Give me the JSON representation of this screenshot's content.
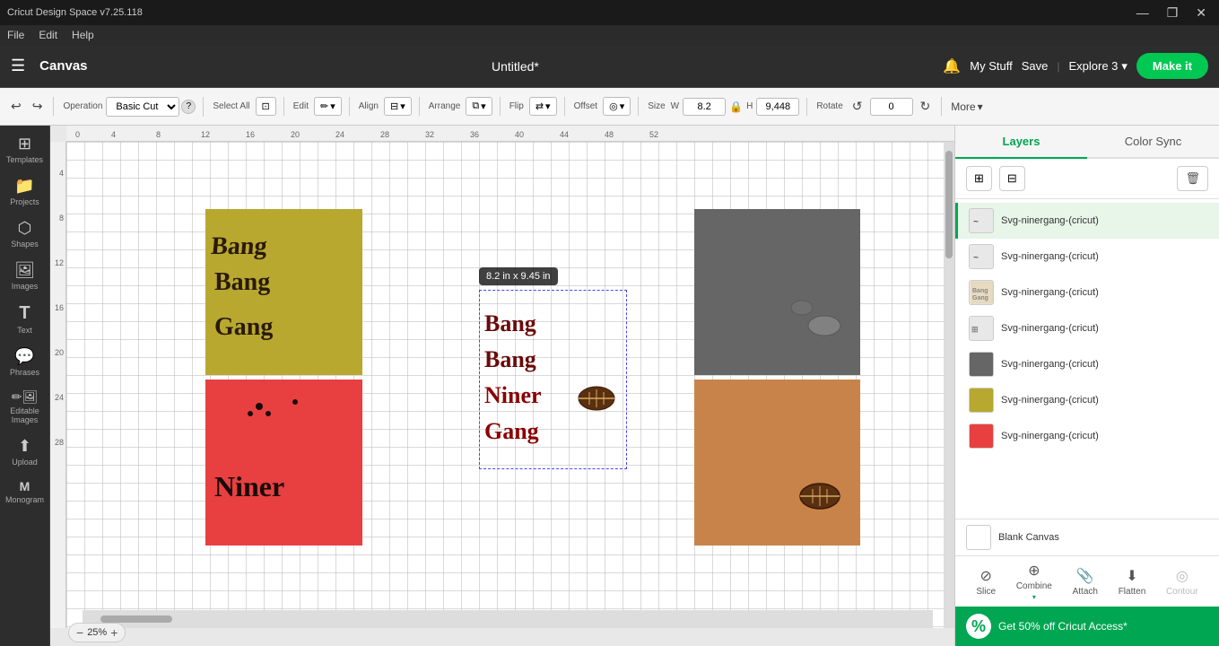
{
  "titlebar": {
    "title": "Cricut Design Space  v7.25.118",
    "controls": {
      "minimize": "—",
      "maximize": "❐",
      "close": "✕"
    }
  },
  "menubar": {
    "items": [
      "File",
      "Edit",
      "Help"
    ]
  },
  "header": {
    "hamburger": "☰",
    "canvas_label": "Canvas",
    "doc_title": "Untitled*",
    "bell_label": "🔔",
    "mystuff_label": "My Stuff",
    "save_label": "Save",
    "divider": "|",
    "machine_label": "Explore 3",
    "machine_chevron": "▾",
    "makeit_label": "Make it"
  },
  "toolbar": {
    "undo_label": "↩",
    "redo_label": "↪",
    "operation_label": "Operation",
    "operation_value": "Basic Cut",
    "help_label": "?",
    "select_all_label": "Select All",
    "edit_label": "Edit",
    "edit_icon": "✏",
    "align_label": "Align",
    "arrange_label": "Arrange",
    "flip_label": "Flip",
    "offset_label": "Offset",
    "size_label": "Size",
    "size_w_label": "W",
    "size_w_value": "8.2",
    "size_h_label": "H",
    "size_h_value": "9,448",
    "lock_icon": "🔒",
    "rotate_label": "Rotate",
    "rotate_value": "0",
    "more_label": "More",
    "more_chevron": "▾"
  },
  "left_sidebar": {
    "items": [
      {
        "id": "templates",
        "icon": "⊞",
        "label": "Templates"
      },
      {
        "id": "projects",
        "icon": "📁",
        "label": "Projects"
      },
      {
        "id": "shapes",
        "icon": "⬡",
        "label": "Shapes"
      },
      {
        "id": "images",
        "icon": "🖼",
        "label": "Images"
      },
      {
        "id": "text",
        "icon": "T",
        "label": "Text"
      },
      {
        "id": "phrases",
        "icon": "💬",
        "label": "Phrases"
      },
      {
        "id": "editable_images",
        "icon": "✏",
        "label": "Editable Images"
      },
      {
        "id": "upload",
        "icon": "⬆",
        "label": "Upload"
      },
      {
        "id": "monogram",
        "icon": "M",
        "label": "Monogram"
      }
    ]
  },
  "canvas": {
    "zoom_level": "25%",
    "zoom_minus": "−",
    "zoom_plus": "+",
    "size_tooltip": "8.2  in x 9.45  in",
    "ruler_marks_h": [
      "0",
      "4",
      "8",
      "12",
      "16",
      "20",
      "24",
      "28",
      "32",
      "36",
      "40",
      "44",
      "48",
      "52"
    ],
    "ruler_marks_v": [
      "4",
      "8",
      "12",
      "16",
      "20",
      "24",
      "28"
    ]
  },
  "right_panel": {
    "tabs": [
      {
        "id": "layers",
        "label": "Layers",
        "active": true
      },
      {
        "id": "color_sync",
        "label": "Color Sync",
        "active": false
      }
    ],
    "actions": {
      "group_icon": "⊞",
      "ungroup_icon": "⊟",
      "delete_icon": "🗑"
    },
    "layers": [
      {
        "id": 1,
        "name": "Svg-ninergang-(cricut)",
        "thumb_color": "#888",
        "thumb_icon": "~",
        "active": true
      },
      {
        "id": 2,
        "name": "Svg-ninergang-(cricut)",
        "thumb_color": "#888",
        "thumb_icon": "~",
        "active": false
      },
      {
        "id": 3,
        "name": "Svg-ninergang-(cricut)",
        "thumb_color": "#888",
        "thumb_icon": "▦",
        "active": false
      },
      {
        "id": 4,
        "name": "Svg-ninergang-(cricut)",
        "thumb_color": "#888",
        "thumb_icon": "⊞",
        "active": false
      },
      {
        "id": 5,
        "name": "Svg-ninergang-(cricut)",
        "thumb_color": "#666",
        "thumb_icon": "■",
        "active": false
      },
      {
        "id": 6,
        "name": "Svg-ninergang-(cricut)",
        "thumb_color": "#b8a830",
        "thumb_icon": "■",
        "active": false
      },
      {
        "id": 7,
        "name": "Svg-ninergang-(cricut)",
        "thumb_color": "#e84040",
        "thumb_icon": "■",
        "active": false
      }
    ],
    "blank_canvas": {
      "label": "Blank Canvas",
      "thumb_color": "#fff"
    }
  },
  "bottom_tools": {
    "items": [
      {
        "id": "slice",
        "icon": "⊘",
        "label": "Slice",
        "enabled": true
      },
      {
        "id": "combine",
        "icon": "⊕",
        "label": "Combine",
        "enabled": true
      },
      {
        "id": "attach",
        "icon": "📎",
        "label": "Attach",
        "enabled": true
      },
      {
        "id": "flatten",
        "icon": "⬇",
        "label": "Flatten",
        "enabled": true
      },
      {
        "id": "contour",
        "icon": "◎",
        "label": "Contour",
        "enabled": false
      }
    ]
  },
  "promo": {
    "icon": "%",
    "text": "Get 50% off Cricut Access*"
  }
}
